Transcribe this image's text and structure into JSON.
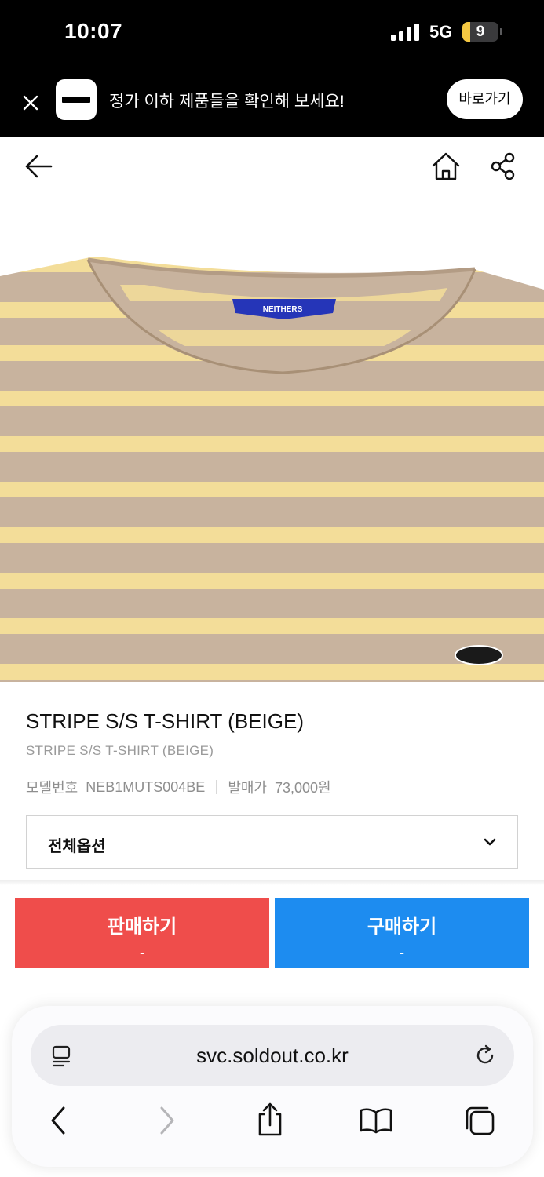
{
  "status_bar": {
    "time": "10:07",
    "network": "5G",
    "battery": "9"
  },
  "banner": {
    "text": "정가 이하 제품들을 확인해 보세요!",
    "button": "바로가기"
  },
  "product": {
    "image_label": "NEITHERS",
    "title": "STRIPE S/S T-SHIRT (BEIGE)",
    "subtitle": "STRIPE S/S T-SHIRT (BEIGE)",
    "model_label": "모델번호",
    "model_number": "NEB1MUTS004BE",
    "price_label": "발매가",
    "price": "73,000원",
    "option_label": "전체옵션"
  },
  "actions": {
    "sell_label": "판매하기",
    "sell_price": "-",
    "buy_label": "구매하기",
    "buy_price": "-"
  },
  "browser": {
    "url": "svc.soldout.co.kr"
  },
  "colors": {
    "sell": "#ef4d4b",
    "buy": "#1d8cf0",
    "stripe_light": "#f3dd99",
    "stripe_dark": "#c8b39e"
  }
}
